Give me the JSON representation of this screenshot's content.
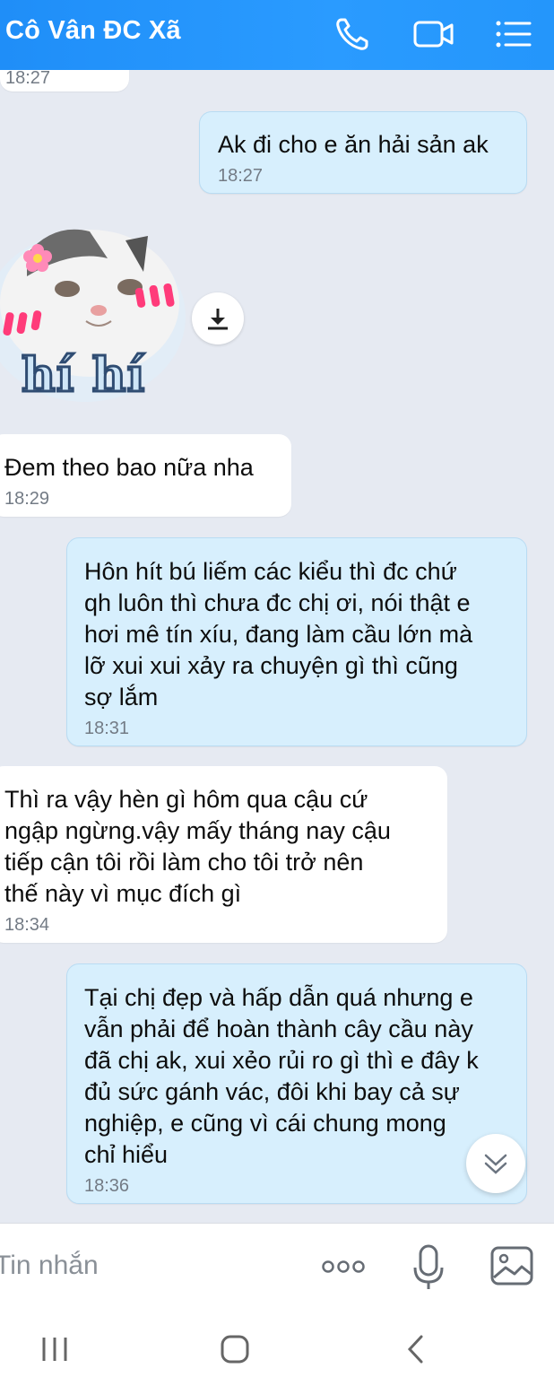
{
  "header": {
    "title": "Cô Vân ĐC Xã",
    "icons": [
      "phone-icon",
      "video-call-icon",
      "menu-list-icon"
    ]
  },
  "messages": [
    {
      "from": "them",
      "time": "18:27",
      "partial": true
    },
    {
      "from": "me",
      "text": "Ak đi cho e ăn hải sản ak",
      "time": "18:27"
    },
    {
      "from": "them",
      "type": "sticker",
      "sticker_text": "hí hí"
    },
    {
      "from": "them",
      "text": "Đem theo bao nữa nha",
      "time": "18:29"
    },
    {
      "from": "me",
      "text": "Hôn hít bú liếm các kiểu thì đc chứ\nqh luôn thì chưa đc chị ơi, nói thật e\nhơi mê tín xíu, đang làm cầu lớn mà\nlỡ xui xui xảy ra chuyện gì thì cũng\nsợ lắm",
      "time": "18:31"
    },
    {
      "from": "them",
      "text": "Thì ra vậy hèn gì hôm qua cậu cứ\nngập ngừng.vậy mấy tháng nay cậu\ntiếp cận tôi rồi làm cho tôi trở nên\nthế này vì mục đích gì",
      "time": "18:34"
    },
    {
      "from": "me",
      "text": "Tại chị đẹp và hấp dẫn quá nhưng e\nvẫn phải để hoàn thành cây cầu này\nđã chị ak, xui xẻo rủi ro gì thì e đây k\nđủ sức gánh vác, đôi khi bay cả sự\nnghiệp, e cũng vì cái chung mong\nchỉ hiểu",
      "time": "18:36"
    }
  ],
  "input": {
    "placeholder": "Tin nhắn",
    "icons": [
      "more-options-icon",
      "microphone-icon",
      "image-icon"
    ]
  },
  "nav": {
    "icons": [
      "recent-apps-icon",
      "home-icon",
      "back-icon"
    ]
  },
  "colors": {
    "header": "#2496fb",
    "chat_background": "#e6eaf2",
    "my_bubble": "#d7effd",
    "their_bubble": "#ffffff"
  }
}
